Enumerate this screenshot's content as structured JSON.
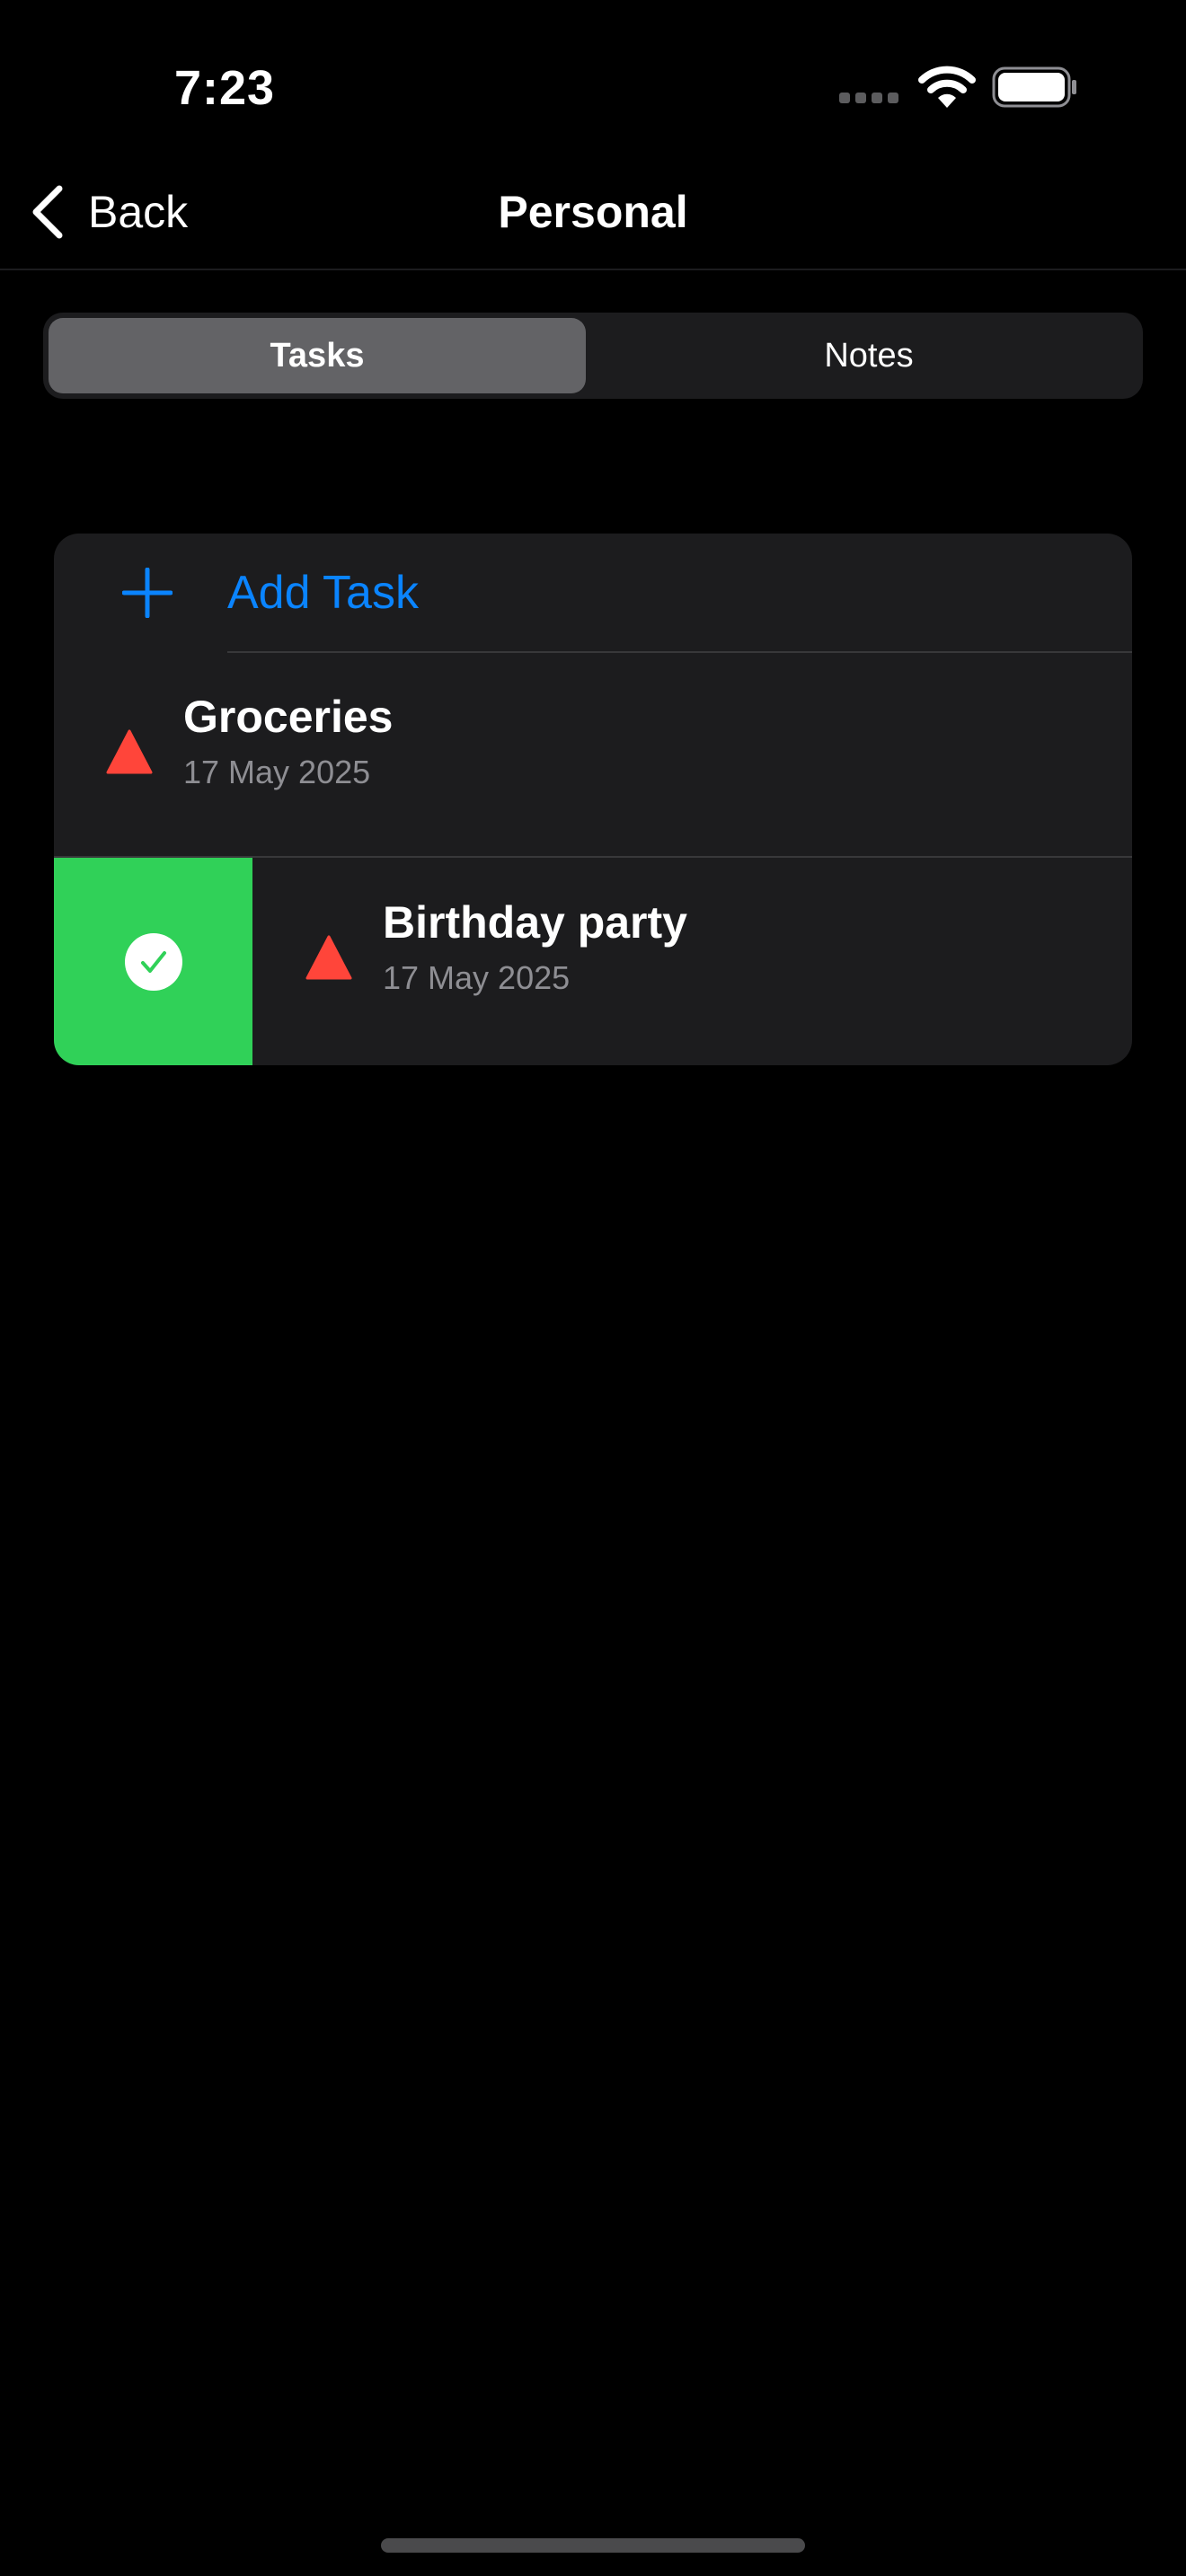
{
  "status_bar": {
    "time": "7:23",
    "icons": [
      "cellular-signal-icon",
      "wifi-icon",
      "battery-icon"
    ]
  },
  "nav": {
    "back_label": "Back",
    "title": "Personal",
    "back_icon": "chevron-left-icon"
  },
  "segmented": {
    "items": [
      {
        "label": "Tasks",
        "selected": true
      },
      {
        "label": "Notes",
        "selected": false
      }
    ]
  },
  "task_list": {
    "add_label": "Add Task",
    "add_icon": "plus-icon",
    "tasks": [
      {
        "title": "Groceries",
        "date": "17 May 2025",
        "priority_icon": "warning-triangle-icon"
      },
      {
        "title": "Birthday party",
        "date": "17 May 2025",
        "priority_icon": "warning-triangle-icon",
        "swipe_action_icon": "checkmark-circle-icon"
      }
    ]
  },
  "colors": {
    "background": "#000000",
    "card": "#1c1c1e",
    "accent": "#0a84ff",
    "priority": "#ff453a",
    "complete": "#30d158",
    "secondary_text": "#8e8e93"
  }
}
